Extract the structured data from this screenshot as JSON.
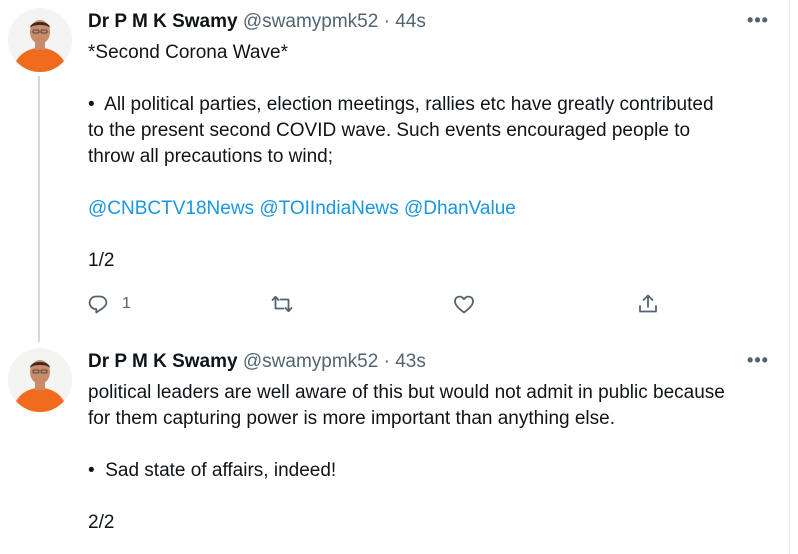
{
  "tweets": [
    {
      "author_name": "Dr P M K Swamy",
      "handle": "@swamypmk52",
      "separator": "·",
      "time": "44s",
      "more_label": "•••",
      "lines": [
        "*Second Corona Wave*",
        "",
        "•  All political parties, election meetings, rallies etc have greatly contributed",
        "to the present second COVID wave. Such events encouraged people to",
        "throw all precautions to wind;",
        ""
      ],
      "mentions": [
        "@CNBCTV18News",
        "@TOIIndiaNews",
        "@DhanValue"
      ],
      "footer_lines": [
        "",
        "1/2"
      ],
      "actions": {
        "reply_icon": "reply-icon",
        "reply_count": "1",
        "retweet_icon": "retweet-icon",
        "like_icon": "heart-icon",
        "share_icon": "share-icon"
      }
    },
    {
      "author_name": "Dr P M K Swamy",
      "handle": "@swamypmk52",
      "separator": "·",
      "time": "43s",
      "more_label": "•••",
      "lines": [
        "political leaders are well aware of this but would not admit in public because",
        "for them capturing power is more important than anything else.",
        "",
        "•  Sad state of affairs, indeed!",
        "",
        "2/2"
      ]
    }
  ],
  "colors": {
    "text": "#0f1419",
    "secondary": "#536471",
    "link": "#1b95e0",
    "thread_line": "#cfd9de",
    "avatar_shirt": "#f06b1e"
  }
}
